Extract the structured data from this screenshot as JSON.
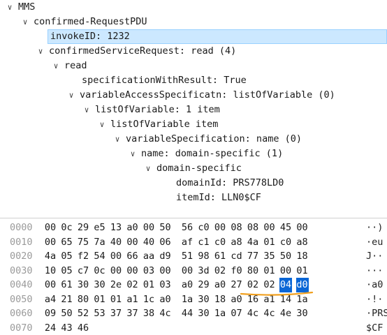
{
  "tree": {
    "rows": [
      {
        "arrow": "∨",
        "label": "MMS"
      },
      {
        "arrow": "∨",
        "label": "confirmed-RequestPDU"
      },
      {
        "arrow": "",
        "label": "invokeID: 1232",
        "selected": true
      },
      {
        "arrow": "∨",
        "label": "confirmedServiceRequest: read (4)"
      },
      {
        "arrow": "∨",
        "label": "read"
      },
      {
        "arrow": "",
        "label": "specificationWithResult: True"
      },
      {
        "arrow": "∨",
        "label": "variableAccessSpecificatn: listOfVariable (0)"
      },
      {
        "arrow": "∨",
        "label": "listOfVariable: 1 item"
      },
      {
        "arrow": "∨",
        "label": "listOfVariable item"
      },
      {
        "arrow": "∨",
        "label": "variableSpecification: name (0)"
      },
      {
        "arrow": "∨",
        "label": "name: domain-specific (1)"
      },
      {
        "arrow": "∨",
        "label": "domain-specific"
      },
      {
        "arrow": "",
        "label": "domainId: PRS778LD0"
      },
      {
        "arrow": "",
        "label": "itemId: LLN0$CF"
      }
    ]
  },
  "hex": {
    "rows": [
      {
        "offset": "0000",
        "bytes": [
          "00",
          "0c",
          "29",
          "e5",
          "13",
          "a0",
          "00",
          "50",
          "56",
          "c0",
          "00",
          "08",
          "08",
          "00",
          "45",
          "00"
        ],
        "ascii": "··)"
      },
      {
        "offset": "0010",
        "bytes": [
          "00",
          "65",
          "75",
          "7a",
          "40",
          "00",
          "40",
          "06",
          "af",
          "c1",
          "c0",
          "a8",
          "4a",
          "01",
          "c0",
          "a8"
        ],
        "ascii": "·eu"
      },
      {
        "offset": "0020",
        "bytes": [
          "4a",
          "05",
          "f2",
          "54",
          "00",
          "66",
          "aa",
          "d9",
          "51",
          "98",
          "61",
          "cd",
          "77",
          "35",
          "50",
          "18"
        ],
        "ascii": "J··"
      },
      {
        "offset": "0030",
        "bytes": [
          "10",
          "05",
          "c7",
          "0c",
          "00",
          "00",
          "03",
          "00",
          "00",
          "3d",
          "02",
          "f0",
          "80",
          "01",
          "00",
          "01"
        ],
        "ascii": "···"
      },
      {
        "offset": "0040",
        "bytes": [
          "00",
          "61",
          "30",
          "30",
          "2e",
          "02",
          "01",
          "03",
          "a0",
          "29",
          "a0",
          "27",
          "02",
          "02",
          "04",
          "d0"
        ],
        "ascii": "·a0"
      },
      {
        "offset": "0050",
        "bytes": [
          "a4",
          "21",
          "80",
          "01",
          "01",
          "a1",
          "1c",
          "a0",
          "1a",
          "30",
          "18",
          "a0",
          "16",
          "a1",
          "14",
          "1a"
        ],
        "ascii": "·!·"
      },
      {
        "offset": "0060",
        "bytes": [
          "09",
          "50",
          "52",
          "53",
          "37",
          "37",
          "38",
          "4c",
          "44",
          "30",
          "1a",
          "07",
          "4c",
          "4c",
          "4e",
          "30"
        ],
        "ascii": "·PRS"
      },
      {
        "offset": "0070",
        "bytes": [
          "24",
          "43",
          "46"
        ],
        "ascii": "$CF"
      }
    ]
  },
  "colors": {
    "selection_bg": "#cce8ff",
    "selection_border": "#99d1ff",
    "byte_highlight": "#0a66d6",
    "annotation_underline": "#f0a020"
  },
  "icons": {
    "expanded": "chevron-down-icon"
  }
}
